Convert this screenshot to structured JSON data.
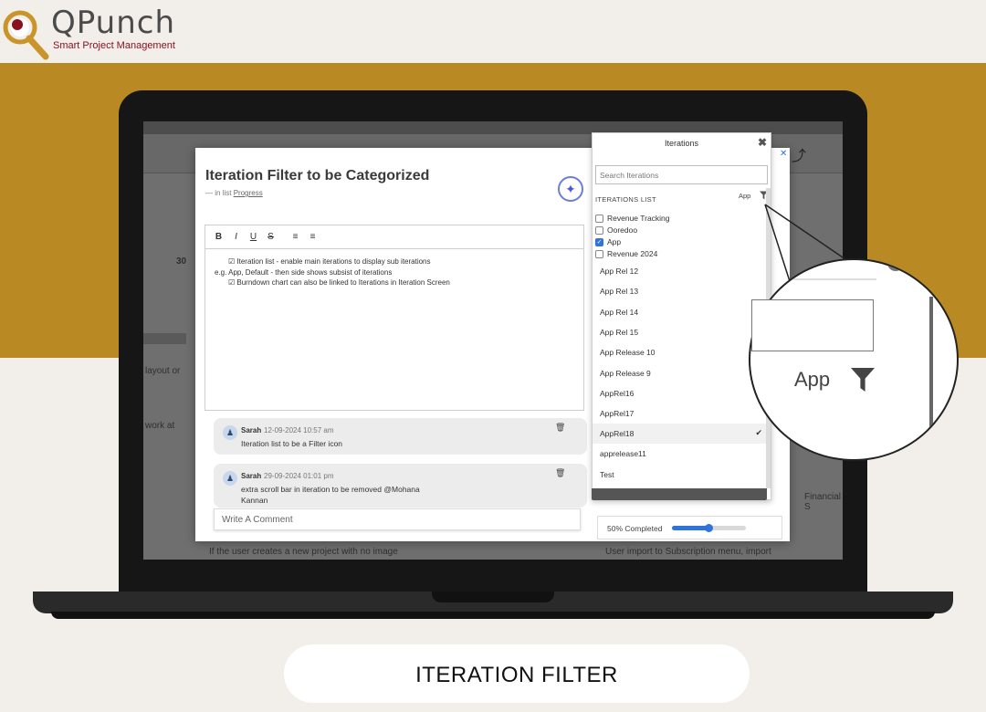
{
  "brand": {
    "name": "QPunch",
    "tagline": "Smart Project Management"
  },
  "background_app": {
    "column_number": "30",
    "snippets": [
      "layout or",
      "work at",
      "If the user creates a new project with no image",
      "User import to Subscription menu, import",
      "Financial S"
    ]
  },
  "task": {
    "title": "Iteration Filter to be Categorized",
    "subtitle_prefix": "— in list",
    "subtitle_list": "Progress"
  },
  "editor": {
    "toolbar": [
      "B",
      "I",
      "U",
      "S",
      "≡",
      "≡"
    ],
    "lines": [
      {
        "text": "☑ Iteration list - enable main iterations to display sub iterations",
        "indent": true
      },
      {
        "text": "e.g. App, Default - then side shows subsist of iterations",
        "indent": false
      },
      {
        "text": "☑ Burndown chart can also be linked to Iterations in Iteration Screen",
        "indent": true
      }
    ]
  },
  "comments": [
    {
      "author": "Sarah",
      "time": "12-09-2024 10:57 am",
      "text": "Iteration list to be a Filter icon"
    },
    {
      "author": "Sarah",
      "time": "29-09-2024 01:01 pm",
      "text": "extra scroll bar in iteration to be removed @Mohana Kannan"
    }
  ],
  "comment_input_placeholder": "Write A Comment",
  "iterations": {
    "title": "Iterations",
    "search_placeholder": "Search Iterations",
    "list_label": "ITERATIONS LIST",
    "filter_value": "App",
    "checkboxes": [
      {
        "label": "Revenue Tracking",
        "checked": false
      },
      {
        "label": "Ooredoo",
        "checked": false
      },
      {
        "label": "App",
        "checked": true
      },
      {
        "label": "Revenue 2024",
        "checked": false
      }
    ],
    "items": [
      {
        "label": "App Rel 12",
        "selected": false
      },
      {
        "label": "App Rel 13",
        "selected": false
      },
      {
        "label": "App Rel 14",
        "selected": false
      },
      {
        "label": "App Rel 15",
        "selected": false
      },
      {
        "label": "App Release 10",
        "selected": false
      },
      {
        "label": "App Release 9",
        "selected": false
      },
      {
        "label": "AppRel16",
        "selected": false
      },
      {
        "label": "AppRel17",
        "selected": false
      },
      {
        "label": "AppRel18",
        "selected": true
      },
      {
        "label": "apprelease11",
        "selected": false
      },
      {
        "label": "Test",
        "selected": false
      }
    ]
  },
  "progress": {
    "label": "50% Completed",
    "value": 0.5
  },
  "zoom": {
    "app_label": "App"
  },
  "caption": "ITERATION FILTER",
  "colors": {
    "gold": "#b98a23",
    "accent": "#2f74d8",
    "logo_red": "#8a1020"
  }
}
